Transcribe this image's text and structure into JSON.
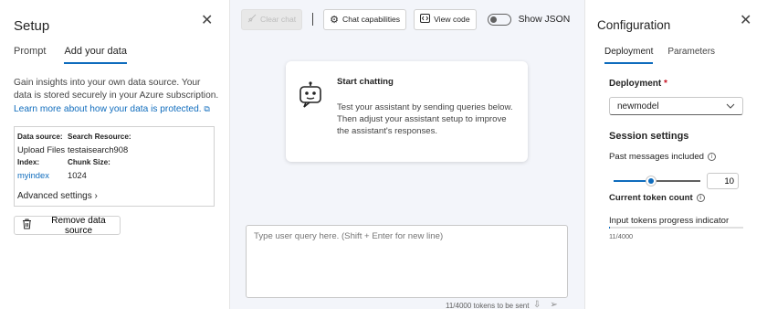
{
  "setup": {
    "title": "Setup",
    "tabs": [
      {
        "label": "Prompt"
      },
      {
        "label": "Add your data"
      }
    ],
    "description": "Gain insights into your own data source. Your data is stored securely in your Azure subscription. ",
    "link_text": "Learn more about how your data is protected.",
    "data_source": {
      "data_source_label": "Data source:",
      "data_source_value": "Upload Files",
      "search_resource_label": "Search Resource:",
      "search_resource_value": "testaisearch908",
      "index_label": "Index:",
      "index_value": "myindex",
      "chunk_size_label": "Chunk Size:",
      "chunk_size_value": "1024",
      "advanced_label": "Advanced settings"
    },
    "remove_button": "Remove data source"
  },
  "toolbar": {
    "clear_chat": "Clear chat",
    "chat_capabilities": "Chat capabilities",
    "view_code": "View code",
    "show_json": "Show JSON"
  },
  "card": {
    "title": "Start chatting",
    "body": "Test your assistant by sending queries below. Then adjust your assistant setup to improve the assistant's responses."
  },
  "chat": {
    "placeholder": "Type user query here. (Shift + Enter for new line)",
    "token_note": "11/4000 tokens to be sent"
  },
  "config": {
    "title": "Configuration",
    "tabs": [
      {
        "label": "Deployment"
      },
      {
        "label": "Parameters"
      }
    ],
    "deployment_label": "Deployment",
    "required_mark": "*",
    "deployment_value": "newmodel",
    "session_title": "Session settings",
    "past_messages_label": "Past messages included",
    "past_messages_value": "10",
    "past_messages_slider_fraction": 0.42,
    "current_token_label": "Current token count",
    "progress_label": "Input tokens progress indicator",
    "progress_value": "11/4000",
    "progress_fraction": 0.00275
  },
  "colors": {
    "accent": "#0f6cbd",
    "required": "#c50f1f"
  }
}
